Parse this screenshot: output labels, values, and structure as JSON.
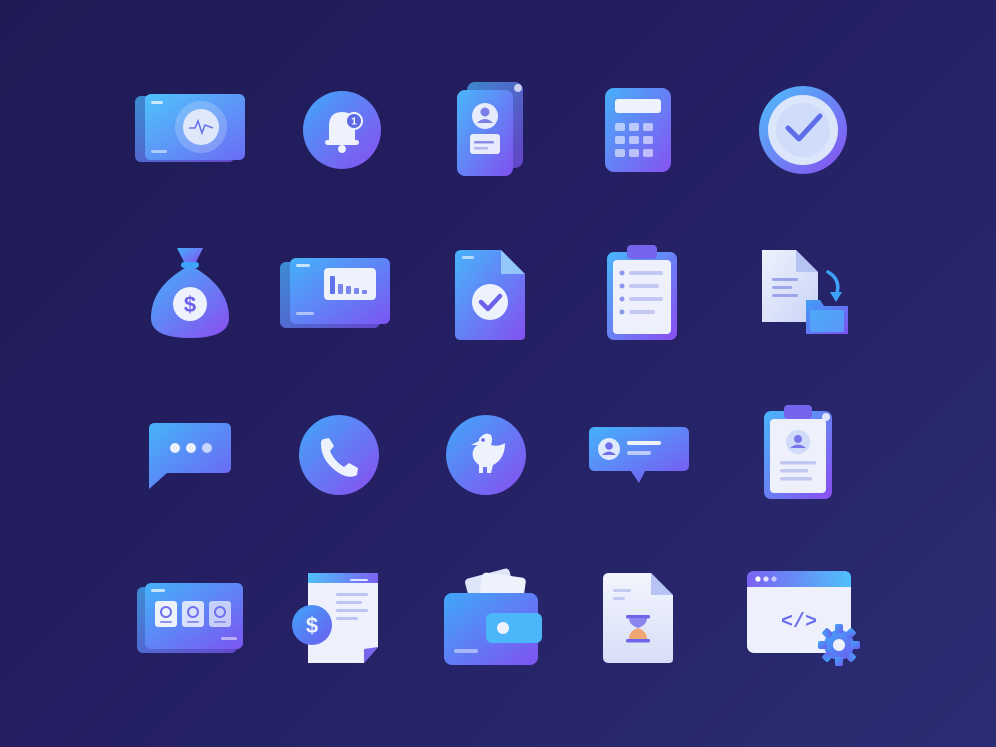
{
  "icons": [
    {
      "name": "dashboard-monitor-icon"
    },
    {
      "name": "notification-bell-icon",
      "badge": "1"
    },
    {
      "name": "profile-cards-icon"
    },
    {
      "name": "calculator-icon"
    },
    {
      "name": "check-clock-icon"
    },
    {
      "name": "money-bag-icon",
      "symbol": "$"
    },
    {
      "name": "analytics-cards-icon"
    },
    {
      "name": "approved-document-icon"
    },
    {
      "name": "clipboard-checklist-icon"
    },
    {
      "name": "file-to-folder-icon"
    },
    {
      "name": "chat-bubble-icon"
    },
    {
      "name": "phone-call-icon"
    },
    {
      "name": "bird-icon"
    },
    {
      "name": "user-message-icon"
    },
    {
      "name": "contact-clipboard-icon"
    },
    {
      "name": "media-cards-icon"
    },
    {
      "name": "invoice-icon",
      "symbol": "$"
    },
    {
      "name": "wallet-icon"
    },
    {
      "name": "pending-document-icon"
    },
    {
      "name": "code-settings-icon",
      "code_label": "</>"
    }
  ],
  "colors": {
    "background": "#221e5e",
    "gradient_light": "#3fa0f8",
    "gradient_dark": "#8a4cf0",
    "card_light": "#eef1fb"
  }
}
